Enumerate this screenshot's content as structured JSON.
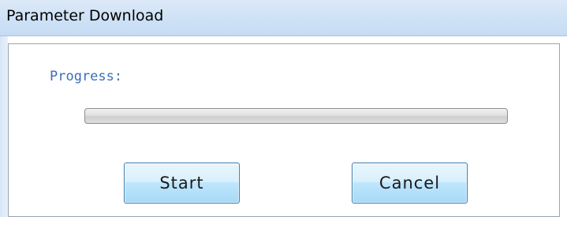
{
  "window": {
    "title": "Parameter Download"
  },
  "progress": {
    "label": "Progress:",
    "value_percent": 0
  },
  "buttons": {
    "start_label": "Start",
    "cancel_label": "Cancel"
  },
  "colors": {
    "title_bar": "#cfe2f6",
    "label_text": "#3a6fb8",
    "button_border": "#3c7fb1",
    "button_fill": "#bee6fd"
  }
}
